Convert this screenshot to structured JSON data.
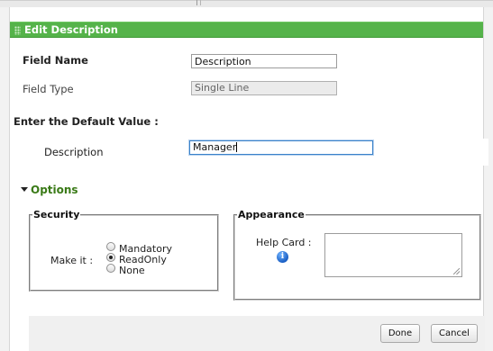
{
  "dialog": {
    "title": "Edit Description"
  },
  "fields": {
    "field_name": {
      "label": "Field Name",
      "value": "Description"
    },
    "field_type": {
      "label": "Field Type",
      "value": "Single Line"
    }
  },
  "default_value": {
    "heading": "Enter the Default Value :",
    "label": "Description",
    "value": "Manager"
  },
  "options": {
    "title": "Options",
    "security": {
      "legend": "Security",
      "make_it_label": "Make it :",
      "choices": [
        {
          "label": "Mandatory",
          "selected": false
        },
        {
          "label": "ReadOnly",
          "selected": true
        },
        {
          "label": "None",
          "selected": false
        }
      ]
    },
    "appearance": {
      "legend": "Appearance",
      "help_card_label": "Help Card :",
      "info_icon": "info-icon",
      "help_card_value": ""
    }
  },
  "buttons": {
    "done": "Done",
    "cancel": "Cancel"
  },
  "colors": {
    "titlebar": "#55b34a",
    "options_title": "#3a7a17"
  }
}
